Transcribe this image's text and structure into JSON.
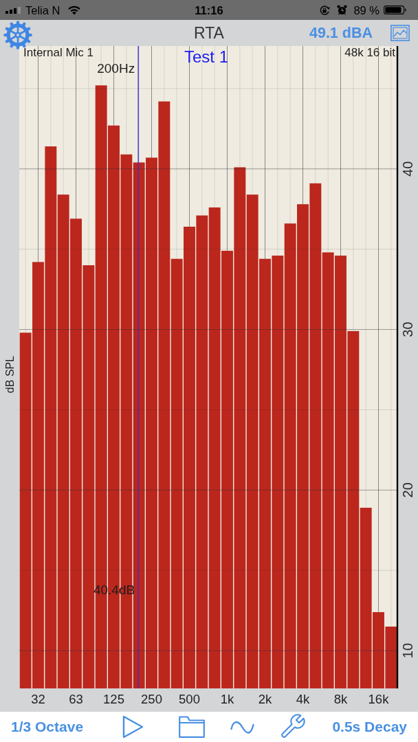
{
  "status_bar": {
    "carrier": "Telia N",
    "time": "11:16",
    "battery": "89 %"
  },
  "nav_bar": {
    "title": "RTA",
    "reading": "49.1 dBA"
  },
  "analyzer": {
    "input": "Internal Mic 1",
    "format": "48k 16 bit",
    "chart_data": {
      "type": "bar",
      "ylabel": "dB SPL",
      "categories": [
        null,
        "32",
        null,
        null,
        "63",
        null,
        null,
        "125",
        null,
        null,
        "250",
        null,
        null,
        "500",
        null,
        null,
        "1k",
        null,
        null,
        "2k",
        null,
        null,
        "4k",
        null,
        null,
        "8k",
        null,
        null,
        "16k",
        null
      ],
      "series": [
        {
          "name": "Test 1",
          "color": "#bb271d",
          "values": [
            29.8,
            34.2,
            41.4,
            38.4,
            36.9,
            34.0,
            45.2,
            42.7,
            40.9,
            40.4,
            40.7,
            44.2,
            34.4,
            36.4,
            37.1,
            37.6,
            34.9,
            40.1,
            38.4,
            34.4,
            34.6,
            36.6,
            37.8,
            39.1,
            34.8,
            34.6,
            29.9,
            18.9,
            12.4,
            11.5
          ]
        }
      ],
      "ylim": [
        7.65,
        47.65
      ],
      "yticks": [
        10,
        20,
        30,
        40
      ],
      "grid": true,
      "annotations": [
        "200Hz",
        "40.4dB"
      ]
    }
  },
  "toolbar": {
    "bands_button": "1/3 Octave",
    "decay_button": "0.5s Decay"
  }
}
